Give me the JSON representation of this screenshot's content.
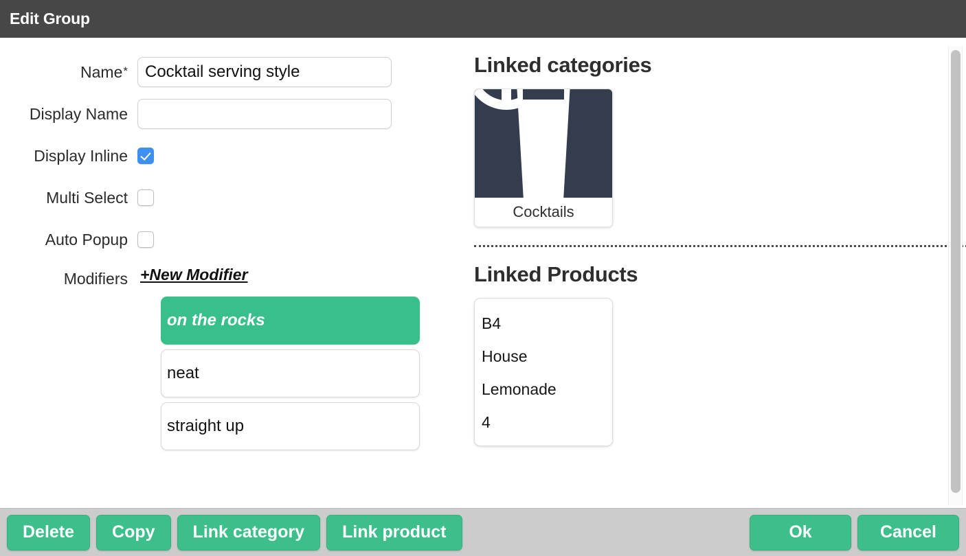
{
  "window": {
    "title": "Edit Group"
  },
  "form": {
    "name": {
      "label": "Name",
      "required_marker": "*",
      "value": "Cocktail serving style",
      "placeholder": ""
    },
    "display_name": {
      "label": "Display Name",
      "value": "",
      "placeholder": ""
    },
    "display_inline": {
      "label": "Display Inline",
      "checked": true
    },
    "multi_select": {
      "label": "Multi Select",
      "checked": false
    },
    "auto_popup": {
      "label": "Auto Popup",
      "checked": false
    },
    "modifiers": {
      "label": "Modifiers",
      "new_modifier_link": "+New Modifier",
      "items": [
        {
          "label": "on the rocks",
          "selected": true
        },
        {
          "label": "neat",
          "selected": false
        },
        {
          "label": "straight up",
          "selected": false
        }
      ]
    }
  },
  "linked_categories": {
    "title": "Linked categories",
    "items": [
      {
        "name": "Cocktails",
        "icon": "cocktail-glass-icon"
      }
    ]
  },
  "linked_products": {
    "title": "Linked Products",
    "items": [
      {
        "lines": [
          "B4",
          "House",
          "Lemonade",
          "4"
        ]
      }
    ]
  },
  "footer": {
    "delete_label": "Delete",
    "copy_label": "Copy",
    "link_category_label": "Link category",
    "link_product_label": "Link product",
    "ok_label": "Ok",
    "cancel_label": "Cancel"
  },
  "colors": {
    "accent_green": "#3cbf8b",
    "titlebar": "#474747",
    "footer_bar": "#cccccc",
    "checkbox_blue": "#3d8ff0",
    "tile_thumb": "#343d4d"
  }
}
